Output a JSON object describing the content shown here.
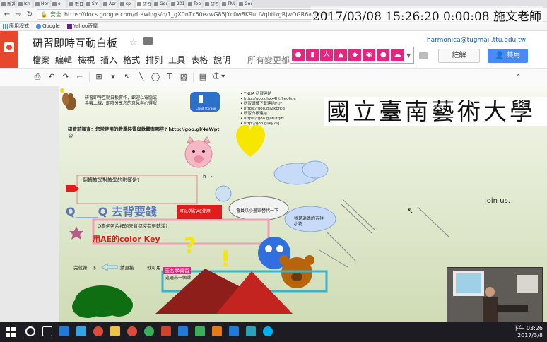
{
  "browser": {
    "tabs": [
      {
        "label": "新選"
      },
      {
        "label": "Isn"
      },
      {
        "label": "Hor"
      },
      {
        "label": "ol"
      },
      {
        "label": "數日"
      },
      {
        "label": "Sm"
      },
      {
        "label": "Apr"
      },
      {
        "label": "sp"
      },
      {
        "label": "研習",
        "active": true
      },
      {
        "label": "Goo"
      },
      {
        "label": "201"
      },
      {
        "label": "Tee"
      },
      {
        "label": "研習"
      },
      {
        "label": "TNU"
      },
      {
        "label": "Goo"
      }
    ],
    "secure_label": "安全",
    "url": "https://docs.google.com/drawings/d/1_gX0nTx60ezwG85jYc0w8K9uUVqbtikgRjwOGR6a_0/edit",
    "bookmarks": [
      {
        "label": "應用程式",
        "icon": "apps-grid-icon"
      },
      {
        "label": "Google",
        "icon": "google-icon"
      },
      {
        "label": "Yahoo奇摩",
        "icon": "yahoo-icon"
      }
    ]
  },
  "recording_timestamp": "2017/03/08 15:26:20 0:00:08 施文老師",
  "app": {
    "title": "研習即時互動白板",
    "menu": [
      "檔案",
      "編輯",
      "檢視",
      "插入",
      "格式",
      "排列",
      "工具",
      "表格",
      "說明"
    ],
    "save_status": "所有變更都已儲存到雲端硬碟",
    "user_email": "harmonica@tugmail.ttu.edu.tw",
    "comment_label": "註解",
    "share_label": "共用"
  },
  "toolbar": {
    "annotate_label": "注"
  },
  "drawing": {
    "intro_text_line1": "研習即時互動白板實作，歡迎以電腦或",
    "intro_text_line2": "手機上線，即時分享您的意見與心得喔",
    "cloud_label": "Cloud Storage",
    "resource_list": [
      "TNUA 研習連結",
      "http://goo.gl/xx4htf9eo6de",
      "研習講義下載連結PDF",
      "https://goo.gl/ZkbfEd",
      "研習白板連結",
      "https://goo.gl/X0fqiH",
      "http://goo.gl/ky79j"
    ],
    "question_banner": "研習前調查：您常使用的教學裝置與軟體有哪些? http://goo.gl/4eWpt",
    "school_name": "國立臺南藝術大學",
    "box_question": "翻轉教學對教學的影響是?",
    "hj_text": "h j -",
    "join_text": "join us.",
    "headline": "Q____Q 去背要錢",
    "red_box_text": "可以搭配AE使用",
    "cloud_text_1": "會員以小畫家替代一下",
    "cloud_text_2": "我是逍遙的吉祥小物",
    "question_box_text": "Q為何照片裡的去背都沒有很乾淨?",
    "ae_text": "用AE的color Key",
    "bottom_text": "完就第二下",
    "arrow_text": "請直接",
    "lower_text": "就可用",
    "tag_text": "匿名學員留",
    "tag_text2": "這邊來一個課"
  },
  "taskbar": {
    "time": "下午 03:26",
    "date": "2017/3/8"
  },
  "colors": {
    "docs_red": "#e8472b",
    "share_blue": "#4a8af4",
    "icon_pink": "#e5257f"
  }
}
